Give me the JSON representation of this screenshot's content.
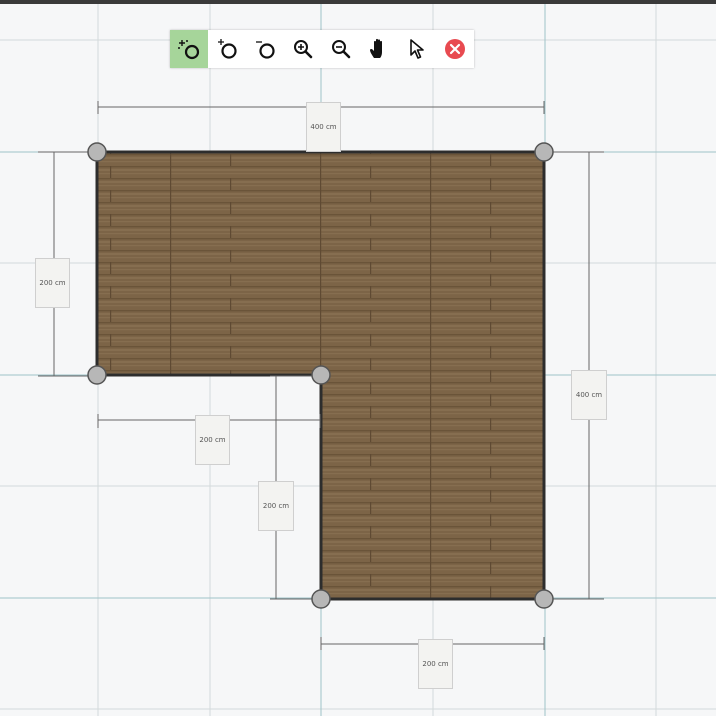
{
  "toolbar": {
    "active_tool": "add-point",
    "tools": [
      {
        "id": "add-point",
        "icon": "add-point-icon"
      },
      {
        "id": "add-circle",
        "icon": "add-circle-icon"
      },
      {
        "id": "remove-circle",
        "icon": "remove-circle-icon"
      },
      {
        "id": "zoom-in",
        "icon": "zoom-in-icon"
      },
      {
        "id": "zoom-out",
        "icon": "zoom-out-icon"
      },
      {
        "id": "pan",
        "icon": "hand-icon"
      },
      {
        "id": "select",
        "icon": "cursor-pointer-icon"
      },
      {
        "id": "close",
        "icon": "close-icon"
      }
    ],
    "colors": {
      "active": "#a6d59a",
      "close": "#e84a50"
    }
  },
  "floor": {
    "texture": "wood-planks",
    "colors": {
      "wood": "#7e6649",
      "outline": "#2d2d2d",
      "grid": "#c8d6d8",
      "dimension": "#555555"
    }
  },
  "dimensions": {
    "top": "400 cm",
    "left": "200 cm",
    "inner_horizontal": "200 cm",
    "inner_vertical": "200 cm",
    "right": "400 cm",
    "bottom": "200 cm"
  }
}
